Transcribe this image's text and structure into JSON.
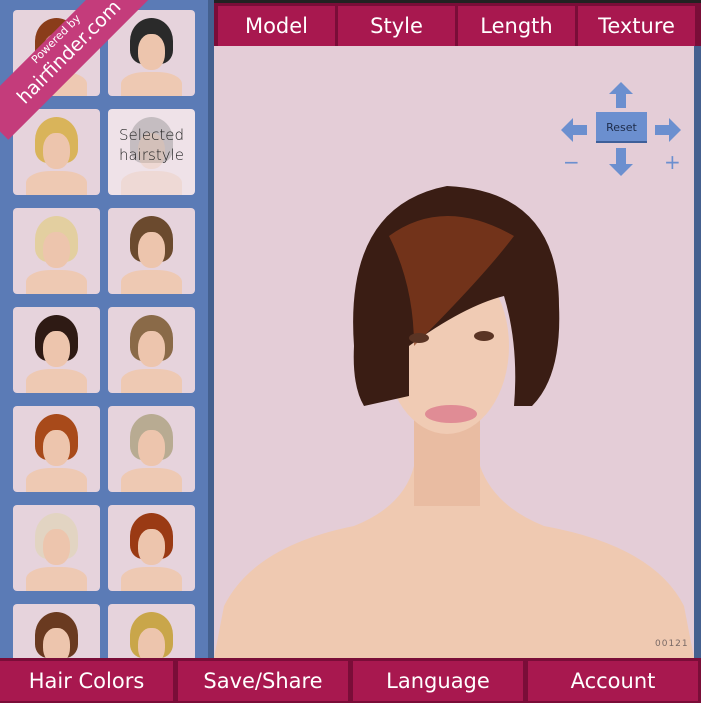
{
  "branding": {
    "line1": "Powered by",
    "line2": "hairfinder.com"
  },
  "sidebar": {
    "selected_label": "Selected hairstyle",
    "hair_colors": [
      "#8a3d1a",
      "#2a2a2a",
      "#d9b45a",
      "#777777",
      "#e3cfa0",
      "#6b4a2e",
      "#2e1a14",
      "#8a6a48",
      "#a84a1a",
      "#b8ab92",
      "#e2d4c2",
      "#9a3a14",
      "#6a3a20",
      "#c9a64a"
    ]
  },
  "topnav": {
    "tabs": [
      "Model",
      "Style",
      "Length",
      "Texture"
    ]
  },
  "controls": {
    "reset_label": "Reset",
    "zoom_out": "−",
    "zoom_in": "+"
  },
  "main": {
    "code": "00121"
  },
  "bottom": {
    "buttons": [
      "Hair Colors",
      "Save/Share",
      "Language",
      "Account"
    ]
  },
  "colors": {
    "accent": "#a8184f",
    "sidebar": "#5b7bb6",
    "canvas": "#e4cdd7",
    "control": "#6b8fcf"
  }
}
